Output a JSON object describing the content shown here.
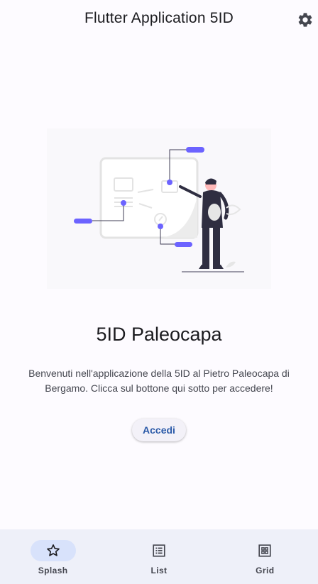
{
  "appbar": {
    "title": "Flutter Application 5ID",
    "settings_icon": "gear-icon"
  },
  "main": {
    "heading": "5ID Paleocapa",
    "description": "Benvenuti nell'applicazione della 5ID al Pietro Paleocapa di Bergamo. Clicca sul bottone qui sotto per accedere!",
    "button_label": "Accedi",
    "illustration": "presentation-illustration"
  },
  "navbar": {
    "items": [
      {
        "label": "Splash",
        "icon": "star-icon",
        "active": true
      },
      {
        "label": "List",
        "icon": "list-icon",
        "active": false
      },
      {
        "label": "Grid",
        "icon": "grid-icon",
        "active": false
      }
    ]
  },
  "colors": {
    "accent": "#6c63ff",
    "button_text": "#2b5aa8",
    "nav_background": "#eef0f9",
    "nav_active_pill": "#d8e2fb",
    "figure_dark": "#2f2e41"
  }
}
